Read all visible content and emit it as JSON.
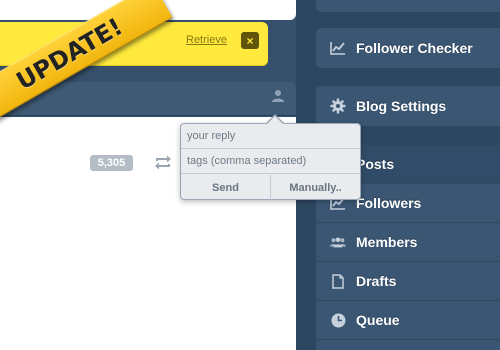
{
  "banner": {
    "ribbon_text": "UPDATE!",
    "retrieve_label": "Retrieve",
    "dismiss_label": "×"
  },
  "post": {
    "note_count": "5,305"
  },
  "reply_popover": {
    "reply_placeholder": "your reply",
    "tags_placeholder": "tags (comma separated)",
    "send_label": "Send",
    "manual_label": "Manually.."
  },
  "sidebar": {
    "follower_checker": "Follower Checker",
    "blog_settings": "Blog Settings",
    "items": [
      {
        "label": "Posts",
        "icon": "posts-icon"
      },
      {
        "label": "Followers",
        "icon": "chart-icon"
      },
      {
        "label": "Members",
        "icon": "members-icon"
      },
      {
        "label": "Drafts",
        "icon": "document-icon"
      },
      {
        "label": "Queue",
        "icon": "clock-icon"
      }
    ]
  },
  "colors": {
    "background": "#2c4762",
    "banner_yellow": "#ffe93d",
    "ribbon_gold": "#f2b50d",
    "sidebar_card": "#3a5673"
  }
}
